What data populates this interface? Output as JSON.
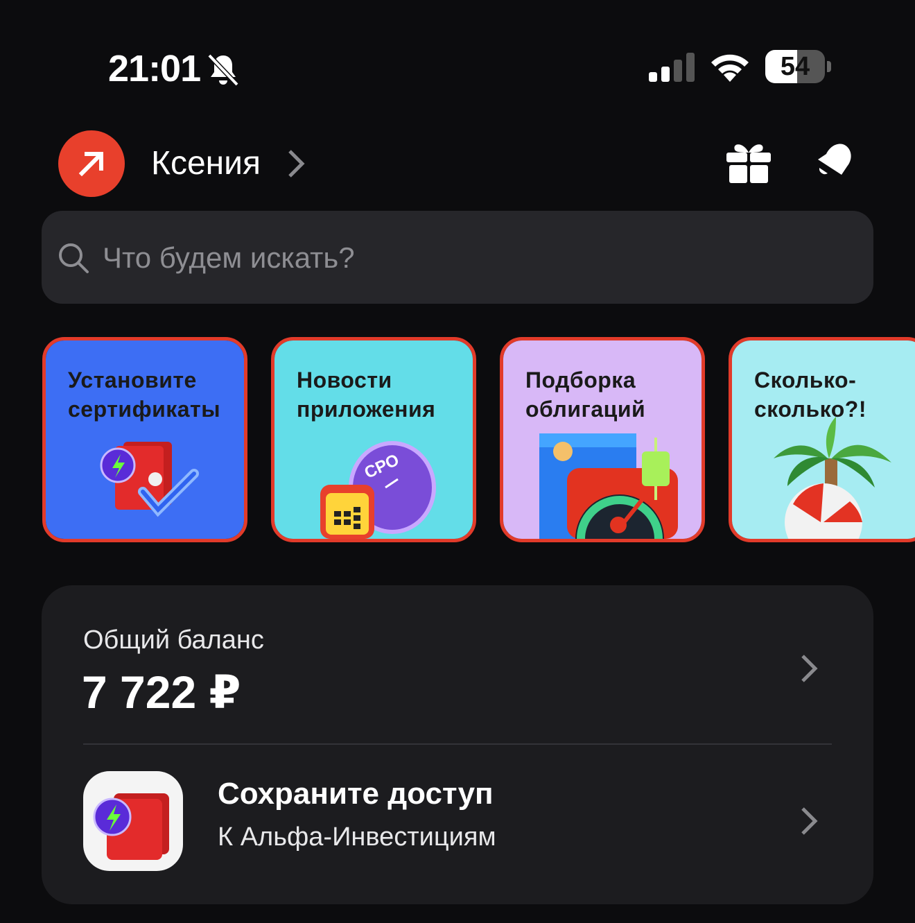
{
  "status_bar": {
    "time": "21:01",
    "battery": "54",
    "battery_level": 0.54,
    "icons": [
      "bell-off-icon",
      "cellular-signal-icon",
      "wifi-icon",
      "battery-icon"
    ]
  },
  "header": {
    "user_name": "Ксения",
    "avatar_icon": "alfa-arrow-icon",
    "avatar_color": "#e8402c",
    "icons": [
      "gift-icon",
      "notifications-icon"
    ]
  },
  "search": {
    "placeholder": "Что будем искать?"
  },
  "stories": [
    {
      "title": "Установите сертификаты",
      "bg": "#3d6ef4"
    },
    {
      "title": "Новости приложения",
      "bg": "#63dde8"
    },
    {
      "title": "Подборка облигаций",
      "bg": "#d8b8f7"
    },
    {
      "title": "Сколько-сколько?!",
      "bg": "#a6ecf2"
    }
  ],
  "balance": {
    "label": "Общий баланс",
    "value": "7 722 ₽"
  },
  "access_card": {
    "title": "Сохраните доступ",
    "subtitle": "К Альфа-Инвестициям"
  },
  "colors": {
    "accent": "#e8402c",
    "card_border": "#e23b2a",
    "background": "#0c0c0e",
    "panel": "#1c1c1f"
  }
}
